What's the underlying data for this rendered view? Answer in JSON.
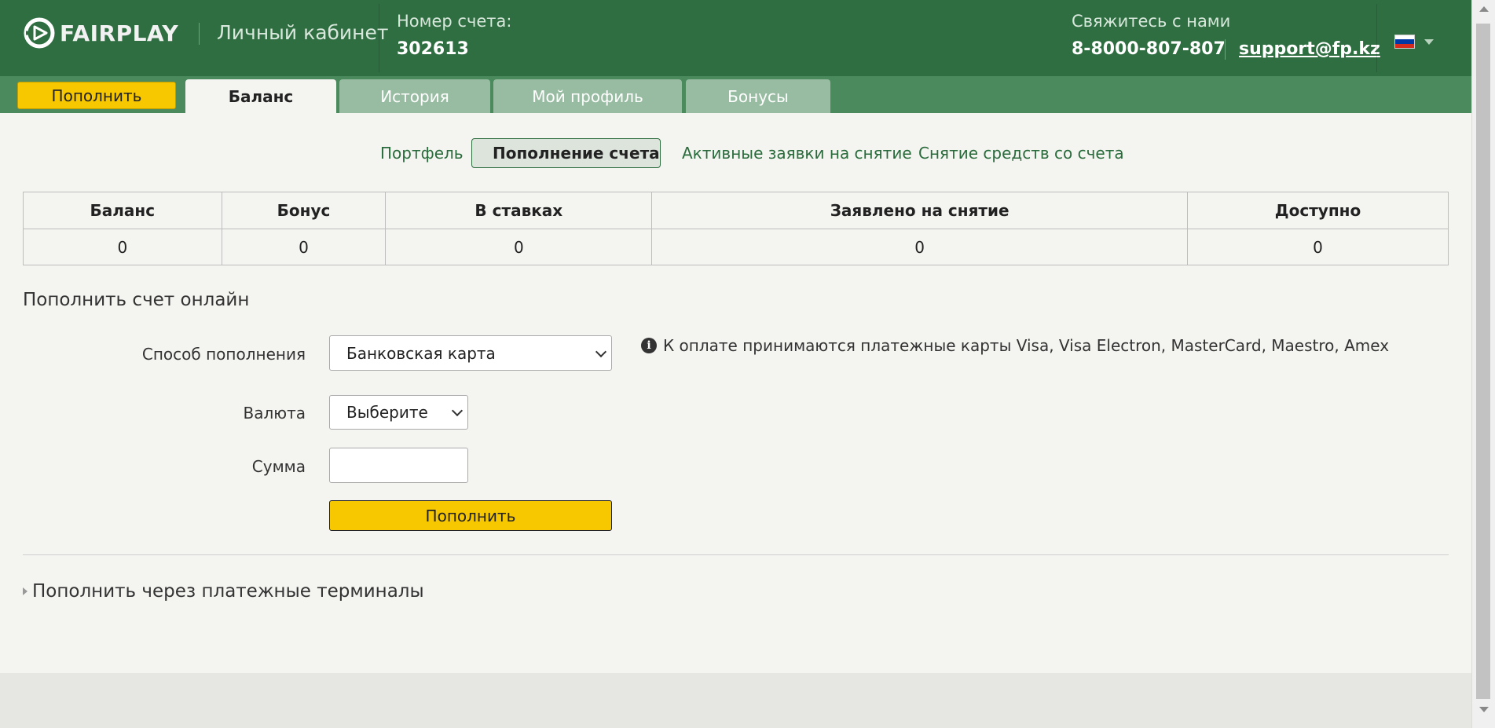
{
  "header": {
    "brand": "FAIRPLAY",
    "section": "Личный кабинет",
    "account_label": "Номер счета:",
    "account_number": "302613",
    "contact_label": "Свяжитесь с нами",
    "phone": "8-8000-807-807",
    "email": "support@fp.kz",
    "language_icon": "russia-flag-icon"
  },
  "tabs": [
    {
      "label": "Пополнить"
    },
    {
      "label": "Баланс"
    },
    {
      "label": "История"
    },
    {
      "label": "Мой профиль"
    },
    {
      "label": "Бонусы"
    }
  ],
  "subnav": [
    {
      "label": "Портфель"
    },
    {
      "label": "Пополнение счета"
    },
    {
      "label": "Активные заявки на снятие"
    },
    {
      "label": "Снятие средств со счета"
    }
  ],
  "balance_table": {
    "headers": [
      "Баланс",
      "Бонус",
      "В ставках",
      "Заявлено на снятие",
      "Доступно"
    ],
    "values": [
      "0",
      "0",
      "0",
      "0",
      "0"
    ]
  },
  "form": {
    "title": "Пополнить счет онлайн",
    "method_label": "Способ пополнения",
    "method_value": "Банковская карта",
    "currency_label": "Валюта",
    "currency_value": "Выберите",
    "amount_label": "Сумма",
    "amount_value": "",
    "submit_label": "Пополнить",
    "info_text": "К оплате принимаются платежные карты Visa, Visa Electron, MasterCard, Maestro, Amex"
  },
  "terminals": {
    "label": "Пополнить через платежные терминалы"
  },
  "colors": {
    "header_bg": "#2e6e41",
    "tabbar_bg": "#4b8a5d",
    "accent_yellow": "#f7c800",
    "page_bg": "#f4f4f0"
  }
}
